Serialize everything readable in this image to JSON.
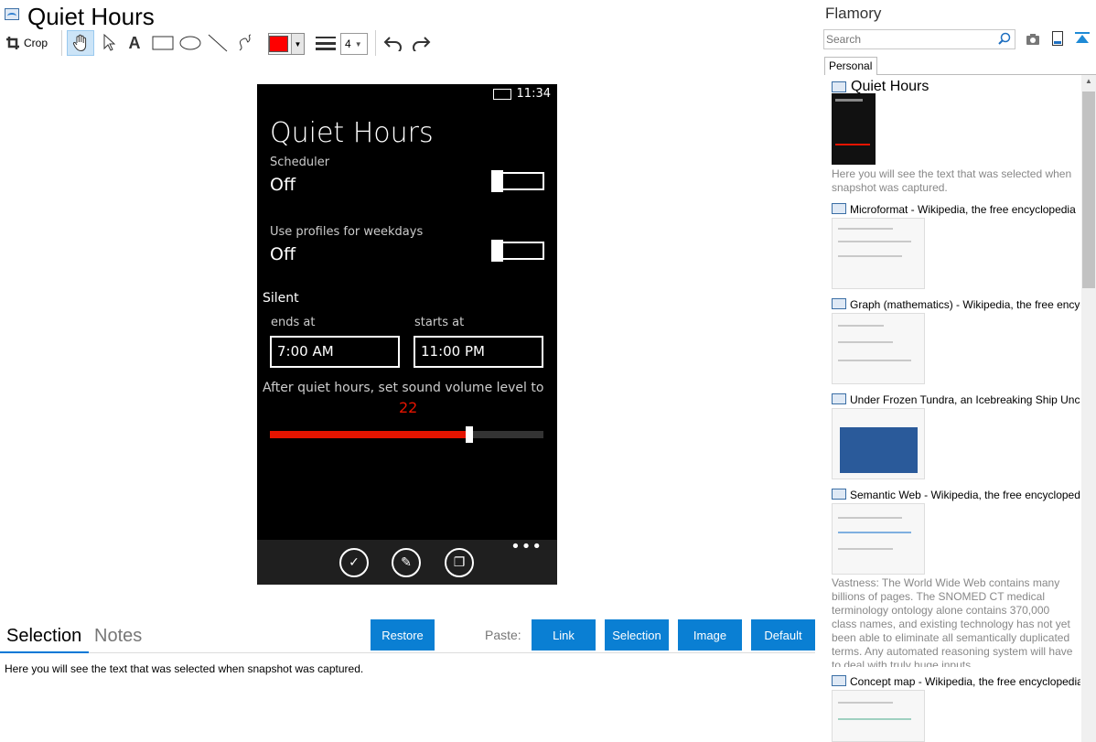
{
  "window": {
    "title": "Quiet Hours"
  },
  "toolbar": {
    "crop_label": "Crop",
    "line_width": "4",
    "color": "#ff0000"
  },
  "phone": {
    "time": "11:34",
    "title": "Quiet Hours",
    "scheduler_label": "Scheduler",
    "scheduler_value": "Off",
    "profiles_label": "Use profiles for weekdays",
    "profiles_value": "Off",
    "silent_label": "Silent",
    "ends_label": "ends at",
    "starts_label": "starts at",
    "ends_value": "7:00 AM",
    "starts_value": "11:00 PM",
    "volume_label": "After quiet hours, set sound volume level to",
    "volume_value": "22",
    "volume_fraction": 0.73,
    "more": "•••"
  },
  "bottom": {
    "tab_selection": "Selection",
    "tab_notes": "Notes",
    "restore_label": "Restore",
    "paste_label": "Paste:",
    "link_label": "Link",
    "selection_label": "Selection",
    "image_label": "Image",
    "default_label": "Default",
    "selection_text": "Here you will see the text that was selected when snapshot was captured."
  },
  "panel": {
    "title": "Flamory",
    "search_placeholder": "Search",
    "tab_personal": "Personal",
    "items": [
      {
        "title": "Quiet Hours",
        "desc": "Here you will see the text that was selected when snapshot was captured."
      },
      {
        "title": "Microformat - Wikipedia, the free encyclopedia"
      },
      {
        "title": "Graph (mathematics) - Wikipedia, the free encyclopedia"
      },
      {
        "title": "Under Frozen Tundra, an Icebreaking Ship Uncovers"
      },
      {
        "title": "Semantic Web - Wikipedia, the free encyclopedia",
        "desc": "Vastness: The World Wide Web contains many billions of pages. The SNOMED CT medical terminology ontology alone contains 370,000 class names, and existing technology has not yet been able to eliminate all semantically duplicated terms. Any automated reasoning system will have to deal with truly huge inputs."
      },
      {
        "title": "Concept map - Wikipedia, the free encyclopedia"
      }
    ]
  }
}
